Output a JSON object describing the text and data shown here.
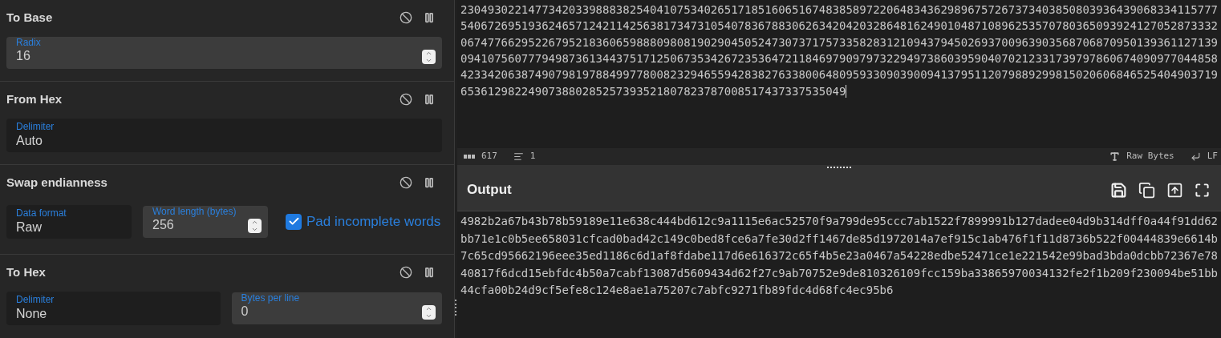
{
  "recipe": [
    {
      "title": "To Base",
      "ingredients": [
        {
          "kind": "number",
          "label": "Radix",
          "value": "16"
        }
      ]
    },
    {
      "title": "From Hex",
      "ingredients": [
        {
          "kind": "text",
          "label": "Delimiter",
          "value": "Auto"
        }
      ]
    },
    {
      "title": "Swap endianness",
      "ingredients": [
        {
          "kind": "text",
          "label": "Data format",
          "value": "Raw"
        },
        {
          "kind": "number",
          "label": "Word length (bytes)",
          "value": "256"
        },
        {
          "kind": "checkbox",
          "label": "Pad incomplete words",
          "checked": true
        }
      ]
    },
    {
      "title": "To Hex",
      "ingredients": [
        {
          "kind": "text",
          "label": "Delimiter",
          "value": "None"
        },
        {
          "kind": "number",
          "label": "Bytes per line",
          "value": "0"
        }
      ]
    }
  ],
  "input": {
    "text": "23049302214773420339888382540410753402651718516065167483858972206483436298967572673734038508039364390683341157775406726951936246571242114256381734731054078367883062634204203286481624901048710896253570780365093924127052873332067477662952267952183606598880980819029045052473073717573358283121094379450269370096390356870687095013936112713909410756077794987361344375171250673534267235364721184697909797322949738603959040702123317397978606740909770448584233420638749079819788499778008232946559428382763380064809593309039009413795112079889299815020606846525404903719653612982249073880285257393521807823787008517437337535049",
    "status": {
      "length": "617",
      "lines": "1",
      "encoding": "Raw Bytes",
      "eol": "LF"
    }
  },
  "output": {
    "title": "Output",
    "text": "4982b2a67b43b78b59189e11e638c444bd612c9a1115e6ac52570f9a799de95ccc7ab1522f7899991b127dadee04d9b314dff0a44f91dd62bb71e1c0b5ee658031cfcad0bad42c149c0bed8fce6a7fe30d2ff1467de85d1972014a7ef915c1ab476f1f11d8736b522f00444839e6614b7c65cd95662196eee35ed1186c6d1af8fdabe117d6e616372c65f4b5e23a0467a54228edbe52471ce1e221542e99bad3bda0dcbb72367e7840817f6dcd15ebfdc4b50a7cabf13087d5609434d62f27c9ab70752e9de810326109fcc159ba33865970034132fe2f1b209f230094be51bb44cfa00b24d9cf5efe8c124e8ae1a75207c7abfc9271fb89fdc4d68fc4ec95b6"
  }
}
